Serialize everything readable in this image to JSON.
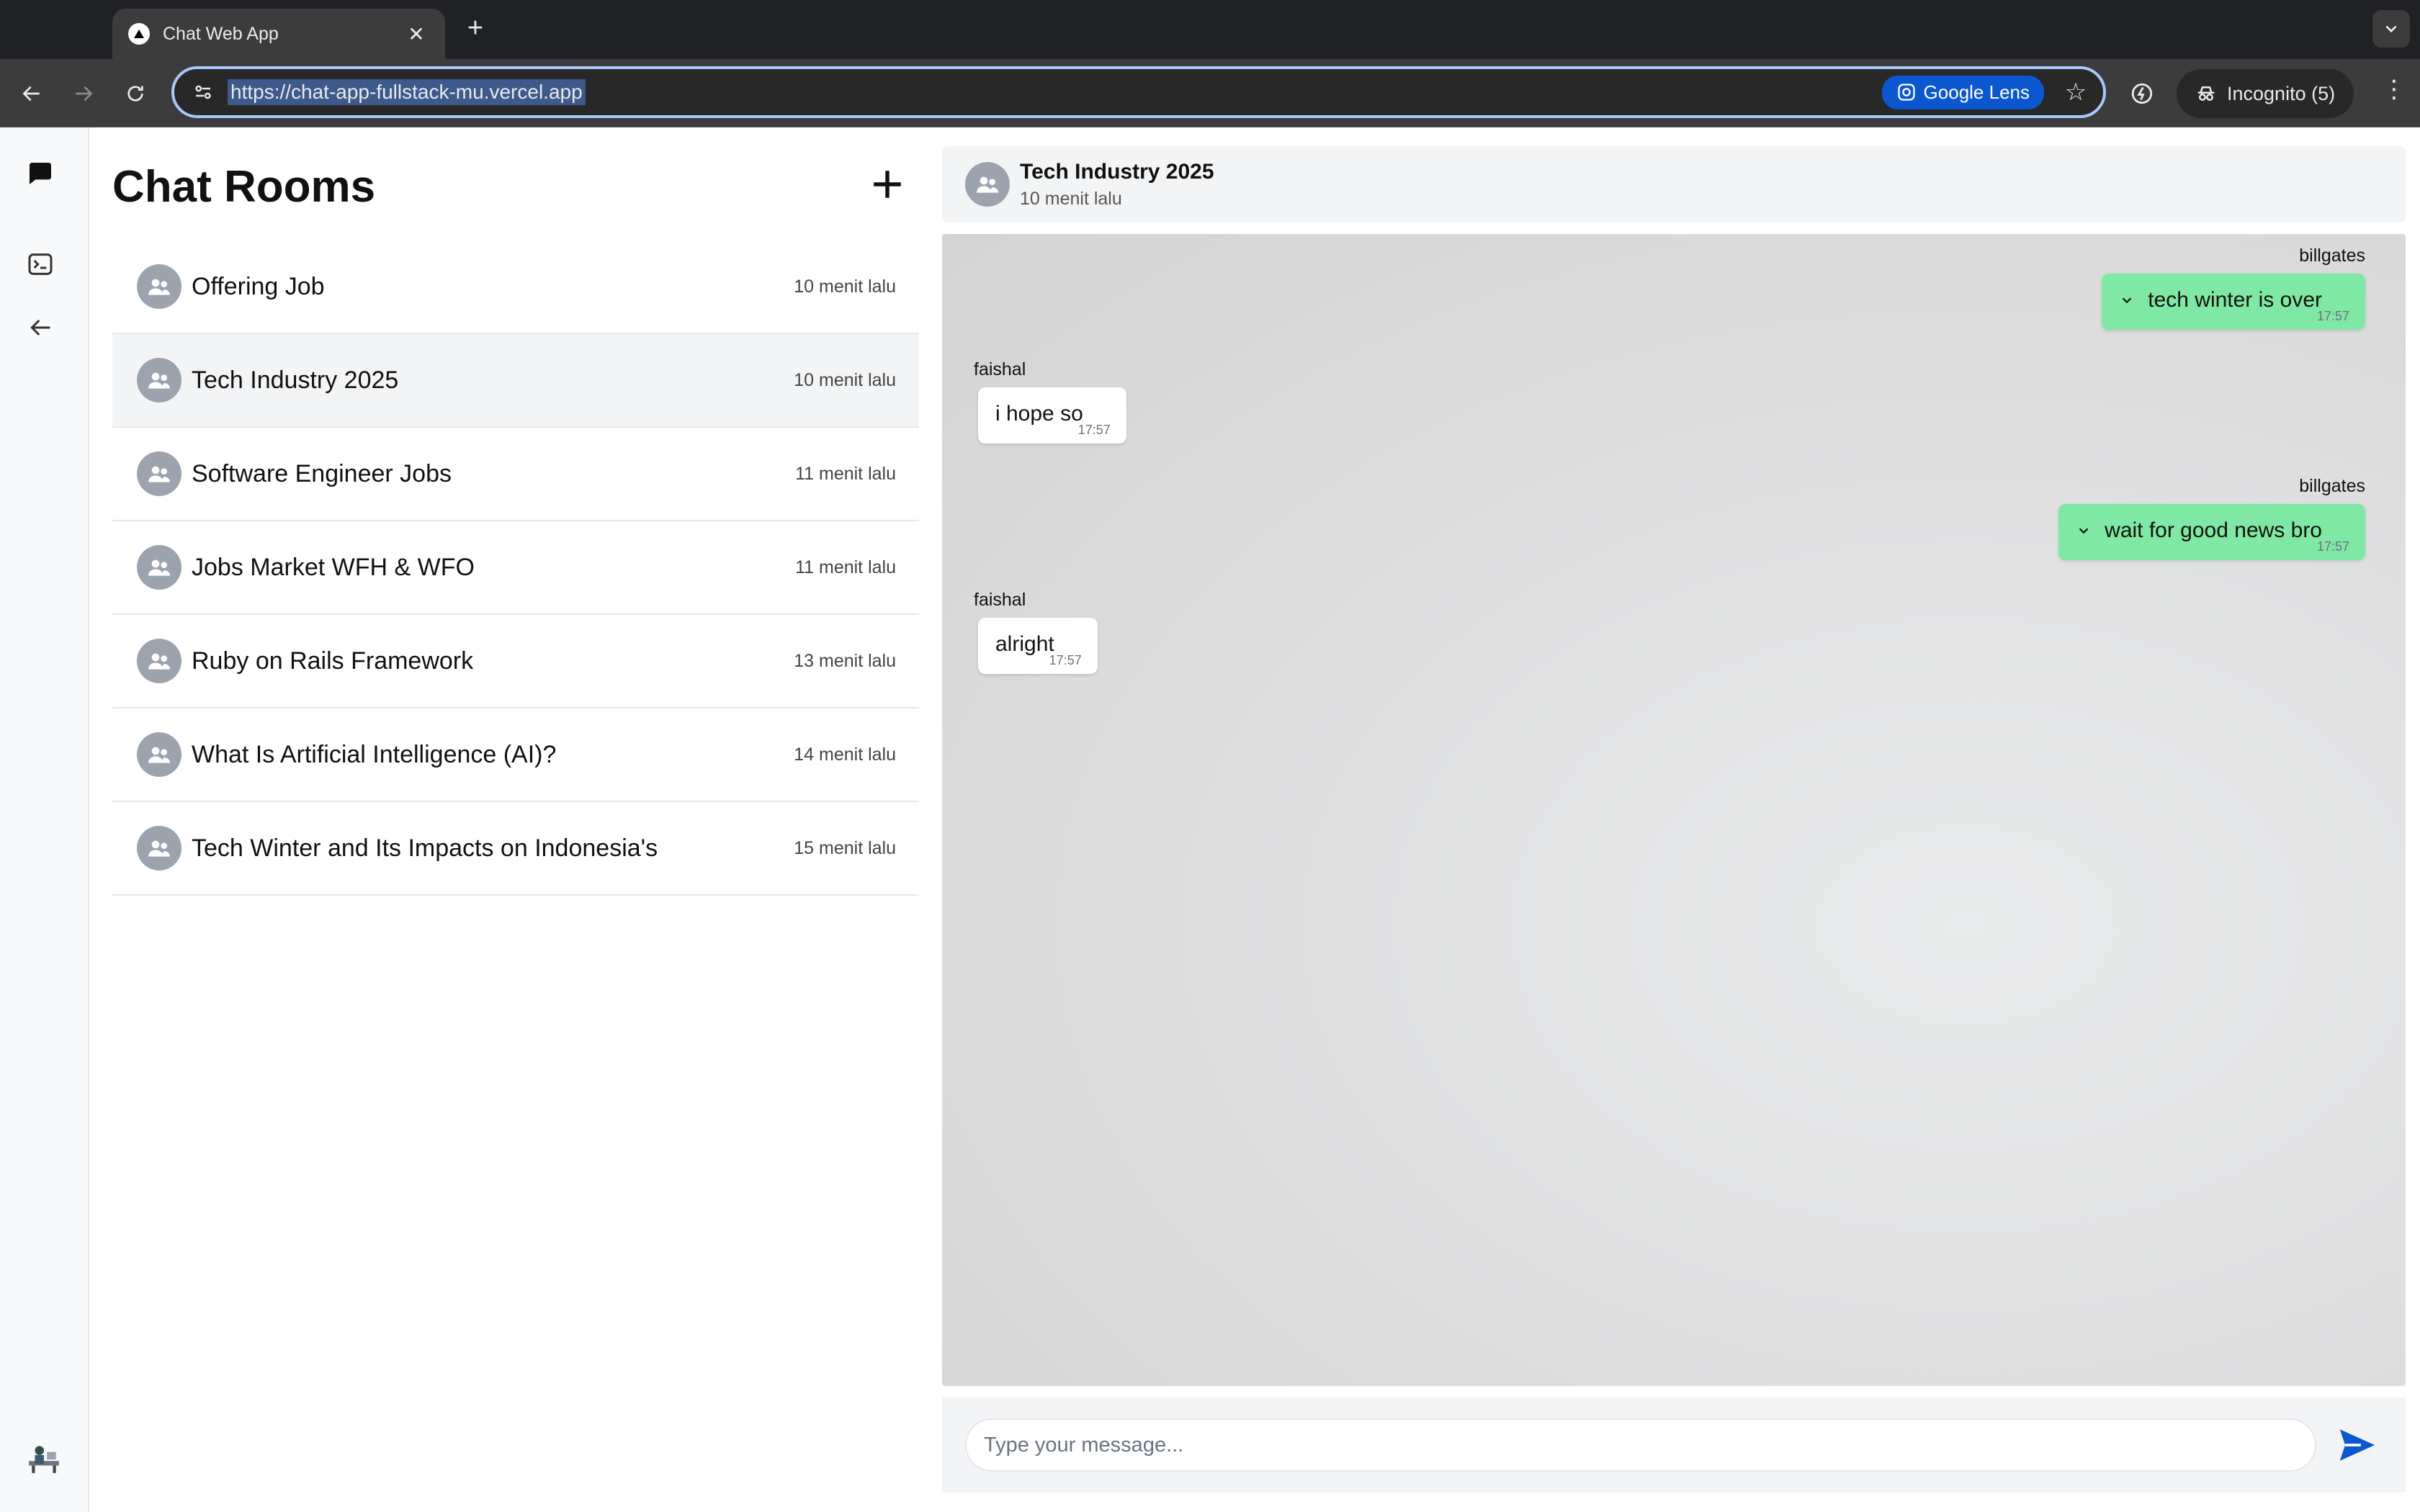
{
  "browser": {
    "tab_title": "Chat Web App",
    "url": "https://chat-app-fullstack-mu.vercel.app",
    "lens_label": "Google Lens",
    "incognito_label": "Incognito (5)"
  },
  "rail": {
    "items": [
      "chat-logo-icon",
      "terminal-icon",
      "back-arrow-icon"
    ],
    "avatar": "user-avatar"
  },
  "rooms": {
    "title": "Chat Rooms",
    "list": [
      {
        "name": "Offering Job",
        "time": "10 menit lalu"
      },
      {
        "name": "Tech Industry 2025",
        "time": "10 menit lalu",
        "active": true
      },
      {
        "name": "Software Engineer Jobs",
        "time": "11 menit lalu"
      },
      {
        "name": "Jobs Market WFH & WFO",
        "time": "11 menit lalu"
      },
      {
        "name": "Ruby on Rails Framework",
        "time": "13 menit lalu"
      },
      {
        "name": "What Is Artificial Intelligence (AI)?",
        "time": "14 menit lalu"
      },
      {
        "name": "Tech Winter and Its Impacts on Indonesia's",
        "time": "15 menit lalu"
      }
    ]
  },
  "chat": {
    "title": "Tech Industry 2025",
    "subtitle": "10 menit lalu",
    "messages": [
      {
        "sender": "billgates",
        "text": "tech winter is over",
        "time": "17:57",
        "mine": true
      },
      {
        "sender": "faishal",
        "text": "i hope so",
        "time": "17:57",
        "mine": false
      },
      {
        "sender": "billgates",
        "text": "wait for good news bro",
        "time": "17:57",
        "mine": true
      },
      {
        "sender": "faishal",
        "text": "alright",
        "time": "17:57",
        "mine": false
      }
    ],
    "composer_placeholder": "Type your message..."
  },
  "colors": {
    "own_bubble": "#7ee8a4",
    "other_bubble": "#ffffff",
    "send_icon": "#0b57d0"
  }
}
